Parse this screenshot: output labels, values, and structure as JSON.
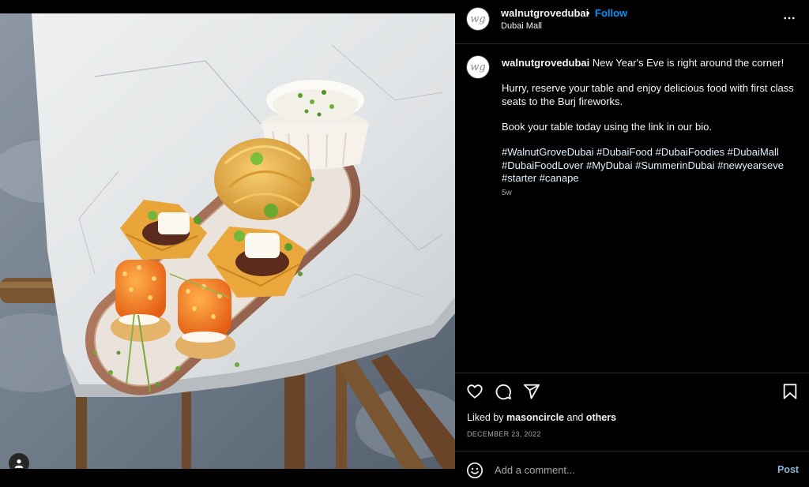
{
  "post": {
    "username": "walnutgrovedubai",
    "separator": "•",
    "follow_label": "Follow",
    "location": "Dubai Mall",
    "avatar_monogram": "wg",
    "more_icon": "more-horizontal-icon",
    "image_alt": "Plate of canapés on a marble table"
  },
  "caption": {
    "username": "walnutgrovedubai",
    "line1": "New Year's Eve is right around the corner!",
    "line2": "Hurry, reserve your table and enjoy delicious food with first class seats to the Burj fireworks.",
    "line3": "Book your table today using the link in our bio.",
    "hashtags": "#WalnutGroveDubai #DubaiFood #DubaiFoodies #DubaiMall #DubaiFoodLover #MyDubai #SummerinDubai #newyearseve #starter #canape",
    "age": "5w"
  },
  "actions": {
    "like_icon": "heart-icon",
    "comment_icon": "comment-icon",
    "share_icon": "send-icon",
    "save_icon": "bookmark-icon"
  },
  "likes": {
    "prefix": "Liked by",
    "user": "masoncircle",
    "joiner": "and",
    "others": "others"
  },
  "date": "DECEMBER 23, 2022",
  "comment": {
    "placeholder": "Add a comment...",
    "post_label": "Post",
    "emoji_icon": "emoji-icon"
  },
  "colors": {
    "background": "#000000",
    "link_blue": "#0095f6",
    "post_button": "#8ab4d8",
    "secondary_text": "#a8a8a8",
    "hashtag": "#e0f1ff"
  }
}
